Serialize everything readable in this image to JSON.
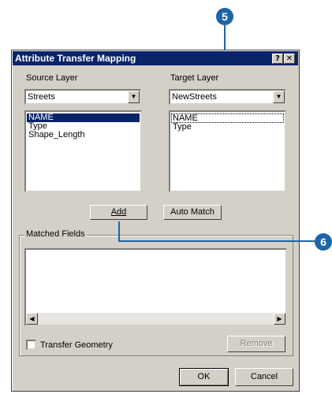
{
  "window": {
    "title": "Attribute Transfer Mapping",
    "help_label": "?",
    "close_label": "✕"
  },
  "source": {
    "label": "Source Layer",
    "selected": "Streets",
    "fields": [
      "NAME",
      "Type",
      "Shape_Length"
    ]
  },
  "target": {
    "label": "Target Layer",
    "selected": "NewStreets",
    "fields": [
      "NAME",
      "Type"
    ]
  },
  "buttons": {
    "add": "Add",
    "auto_match": "Auto Match",
    "remove": "Remove",
    "ok": "OK",
    "cancel": "Cancel"
  },
  "matched": {
    "label": "Matched Fields"
  },
  "transfer_geometry": {
    "label": "Transfer Geometry",
    "checked": false
  },
  "callouts": {
    "step5": "5",
    "step6": "6"
  },
  "icons": {
    "combo": "chevron-down-icon",
    "scroll_left": "arrow-left-icon",
    "scroll_right": "arrow-right-icon"
  },
  "colors": {
    "titlebar": "#0a246a",
    "dialog_face": "#d4d0c8",
    "callout": "#1a66a6"
  }
}
